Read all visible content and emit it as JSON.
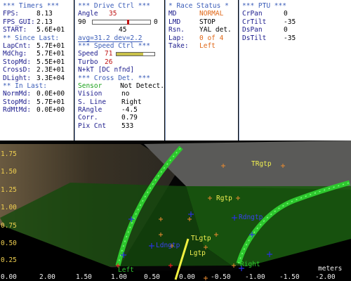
{
  "timers": {
    "header": "*** Timers ***",
    "fps": {
      "label": "FPS:",
      "value": "8.13"
    },
    "fps_gui": {
      "label": "FPS_GUI:",
      "value": "2.13"
    },
    "start": {
      "label": "START:",
      "value": "5.6E+01"
    },
    "since_last_header": "** Since Last:",
    "lapcnt": {
      "label": "LapCnt:",
      "value": "5.7E+01"
    },
    "mdchg": {
      "label": "MdChg:",
      "value": "5.7E+01"
    },
    "stopmd": {
      "label": "StopMd:",
      "value": "5.5E+01"
    },
    "crossd": {
      "label": "CrossD:",
      "value": "2.3E+01"
    },
    "dlight": {
      "label": "DLight:",
      "value": "3.3E+04"
    },
    "in_last_header": "** In Last:",
    "normmd": {
      "label": "NormMd:",
      "value": "0.0E+00"
    },
    "stopmd2": {
      "label": "StopMd:",
      "value": "5.7E+01"
    },
    "rdmtmd": {
      "label": "RdMtMd:",
      "value": "0.0E+00"
    }
  },
  "drive": {
    "header": "***  Drive Ctrl  ***",
    "angle": {
      "label": "Angle",
      "value": "35"
    },
    "slider_min": "90",
    "slider_max": "0",
    "slider_level": 0.61,
    "slider_mid": "45",
    "avg": "avg=31.2 dev=2.2",
    "speed_header": "***  Speed Ctrl  ***",
    "speed": {
      "label": "Speed",
      "value": "71",
      "level": 0.71
    },
    "turbo": {
      "label": "Turbo",
      "value": "26"
    },
    "nkt": "N+kT [DC nfnd]",
    "cross_header": "*** Cross Det. ***",
    "sensor": {
      "label": "Sensor",
      "value": "Not Detect."
    },
    "vision": {
      "label": "Vision",
      "value": "no"
    },
    "sline": {
      "label": "S. Line",
      "value": "Right"
    },
    "rangle": {
      "label": "RAngle",
      "value": "-4.5"
    },
    "corr": {
      "label": "Corr.",
      "value": "0.79"
    },
    "pixcnt": {
      "label": "Pix Cnt",
      "value": "533"
    }
  },
  "race": {
    "header": "* Race Status *",
    "md": {
      "label": "MD",
      "value": "NORMAL"
    },
    "lmd": {
      "label": "LMD",
      "value": "STOP"
    },
    "rsn": {
      "label": "Rsn.",
      "value": "YAL det."
    },
    "lap": {
      "label": "Lap:",
      "value": "0 of 4"
    },
    "take": {
      "label": "Take:",
      "value": "Left"
    }
  },
  "ptu": {
    "header": "*** PTU ***",
    "crpan": {
      "label": "CrPan",
      "value": "0"
    },
    "crtilt": {
      "label": "CrTilt",
      "value": "-35"
    },
    "dspan": {
      "label": "DsPan",
      "value": "0"
    },
    "dstilt": {
      "label": "DsTilt",
      "value": "-35"
    }
  },
  "view": {
    "y_ticks": [
      "1.75",
      "1.50",
      "1.25",
      "1.00",
      "0.75",
      "0.50",
      "0.25"
    ],
    "x_ticks": [
      "2.00",
      "1.50",
      "1.00",
      "0.50",
      "0.00",
      "-0.50",
      "-1.00",
      "-1.50",
      "-2.00"
    ],
    "bottom_extra": [
      "0.00",
      "0.25"
    ],
    "meters": "meters",
    "labels": {
      "trgtp": "TRgtp",
      "rgtp": "Rgtp",
      "ldngtp_r": "Rdngtp",
      "ldngtp_l": "Ldngtp",
      "tlgtp": "TLgtp",
      "lgtp": "Lgtp",
      "left": "Left",
      "right": "Right"
    },
    "colors": {
      "lane_green": "#2ec82e",
      "floor_green": "#1a5a10",
      "marker_blue": "#2a30e0",
      "marker_orange": "#e88a30",
      "label_yellow": "#f0d050"
    }
  }
}
